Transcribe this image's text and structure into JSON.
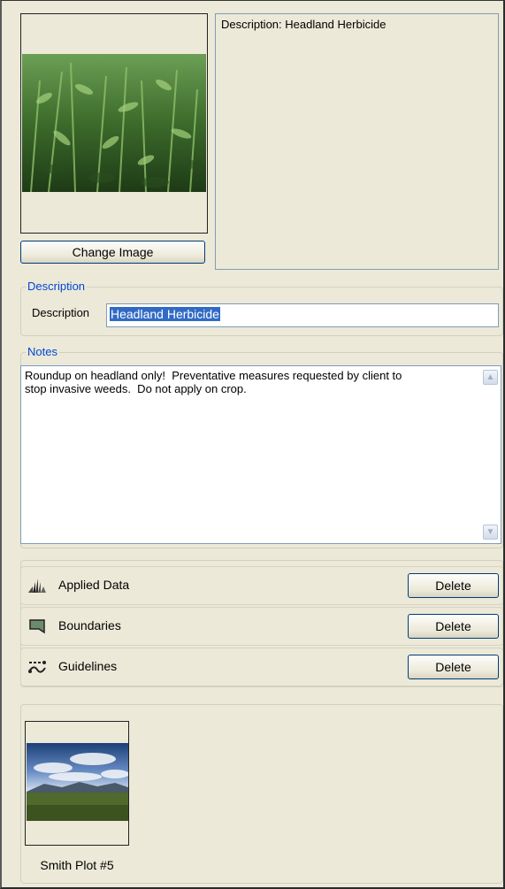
{
  "image_panel": {
    "change_image_label": "Change Image",
    "description_preview": "Description: Headland Herbicide"
  },
  "description_group": {
    "title": "Description",
    "label": "Description",
    "value": "Headland Herbicide"
  },
  "notes_group": {
    "title": "Notes",
    "text": "Roundup on headland only!  Preventative measures requested by client to\nstop invasive weeds.  Do not apply on crop."
  },
  "layers": [
    {
      "label": "Applied Data",
      "icon": "applied-data-icon",
      "delete_label": "Delete"
    },
    {
      "label": "Boundaries",
      "icon": "boundary-icon",
      "delete_label": "Delete"
    },
    {
      "label": "Guidelines",
      "icon": "guidelines-icon",
      "delete_label": "Delete"
    }
  ],
  "field": {
    "name": "Smith Plot #5"
  },
  "colors": {
    "background": "#ece9d8",
    "group_title": "#0046d5",
    "selection": "#316ac5",
    "button_border": "#003c74"
  }
}
